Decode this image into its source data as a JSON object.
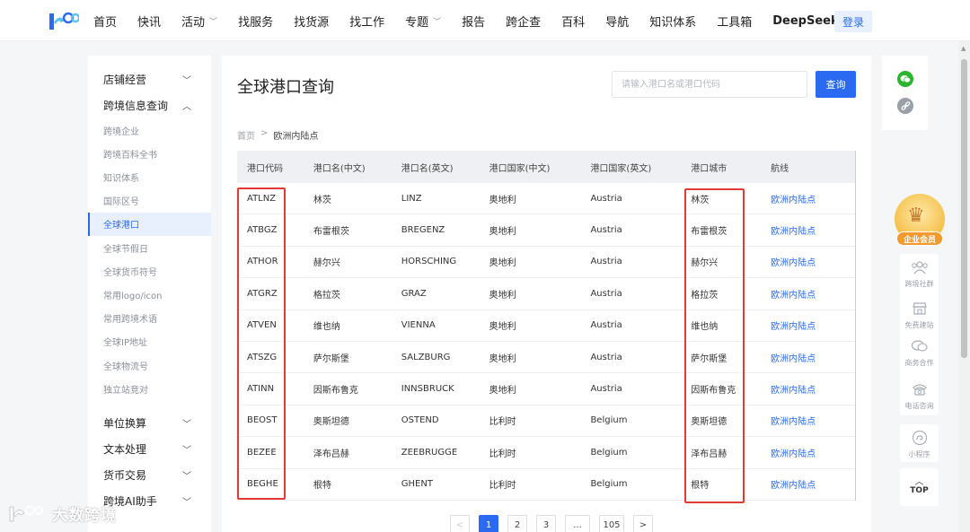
{
  "header": {
    "nav": [
      {
        "label": "首页",
        "dropdown": false
      },
      {
        "label": "快讯",
        "dropdown": false
      },
      {
        "label": "活动",
        "dropdown": true
      },
      {
        "label": "找服务",
        "dropdown": false
      },
      {
        "label": "找货源",
        "dropdown": false
      },
      {
        "label": "找工作",
        "dropdown": false
      },
      {
        "label": "专题",
        "dropdown": true
      },
      {
        "label": "报告",
        "dropdown": false
      },
      {
        "label": "跨企查",
        "dropdown": false
      },
      {
        "label": "百科",
        "dropdown": false
      },
      {
        "label": "导航",
        "dropdown": false
      },
      {
        "label": "知识体系",
        "dropdown": false
      },
      {
        "label": "工具箱",
        "dropdown": false
      },
      {
        "label": "DeepSeek",
        "dropdown": false
      }
    ],
    "login_label": "登录"
  },
  "sidebar": {
    "group_shop": "店铺经营",
    "group_query": "跨境信息查询",
    "items": [
      "跨境企业",
      "跨境百科全书",
      "知识体系",
      "国际区号",
      "全球港口",
      "全球节假日",
      "全球货币符号",
      "常用logo/icon",
      "常用跨境术语",
      "全球IP地址",
      "全球物流号",
      "独立站竞对"
    ],
    "active_index": 4,
    "group_unit": "单位换算",
    "group_text": "文本处理",
    "group_currency": "货币交易",
    "group_ai": "跨境AI助手"
  },
  "main": {
    "title": "全球港口查询",
    "search_placeholder": "请输入港口名或港口代码",
    "search_button": "查询",
    "breadcrumb": {
      "home": "首页",
      "sep": ">",
      "current": "欧洲内陆点"
    },
    "columns": [
      "港口代码",
      "港口名(中文)",
      "港口名(英文)",
      "港口国家(中文)",
      "港口国家(英文)",
      "港口城市",
      "航线"
    ],
    "rows": [
      [
        "ATLNZ",
        "林茨",
        "LINZ",
        "奥地利",
        "Austria",
        "林茨",
        "欧洲内陆点"
      ],
      [
        "ATBGZ",
        "布雷根茨",
        "BREGENZ",
        "奥地利",
        "Austria",
        "布雷根茨",
        "欧洲内陆点"
      ],
      [
        "ATHOR",
        "赫尔兴",
        "HORSCHING",
        "奥地利",
        "Austria",
        "赫尔兴",
        "欧洲内陆点"
      ],
      [
        "ATGRZ",
        "格拉茨",
        "GRAZ",
        "奥地利",
        "Austria",
        "格拉茨",
        "欧洲内陆点"
      ],
      [
        "ATVEN",
        "维也纳",
        "VIENNA",
        "奥地利",
        "Austria",
        "维也纳",
        "欧洲内陆点"
      ],
      [
        "ATSZG",
        "萨尔斯堡",
        "SALZBURG",
        "奥地利",
        "Austria",
        "萨尔斯堡",
        "欧洲内陆点"
      ],
      [
        "ATINN",
        "因斯布鲁克",
        "INNSBRUCK",
        "奥地利",
        "Austria",
        "因斯布鲁克",
        "欧洲内陆点"
      ],
      [
        "BEOST",
        "奥斯坦德",
        "OSTEND",
        "比利时",
        "Belgium",
        "奥斯坦德",
        "欧洲内陆点"
      ],
      [
        "BEZEE",
        "泽布吕赫",
        "ZEEBRUGGE",
        "比利时",
        "Belgium",
        "泽布吕赫",
        "欧洲内陆点"
      ],
      [
        "BEGHE",
        "根特",
        "GHENT",
        "比利时",
        "Belgium",
        "根特",
        "欧洲内陆点"
      ]
    ],
    "pagination": {
      "prev": "<",
      "pages": [
        "1",
        "2",
        "3",
        "...",
        "105"
      ],
      "next": ">",
      "current": "1"
    }
  },
  "right_rail": {
    "vip_label": "企业会员",
    "tools": [
      "跨境社群",
      "免费建站",
      "商务合作",
      "电话咨询"
    ],
    "mini_program": "小程序",
    "top": "TOP"
  },
  "watermark": "大数跨境",
  "colors": {
    "accent": "#2a6af2",
    "highlight": "#e53935",
    "wechat": "#2ab52f",
    "vip": "#f29a2e"
  }
}
